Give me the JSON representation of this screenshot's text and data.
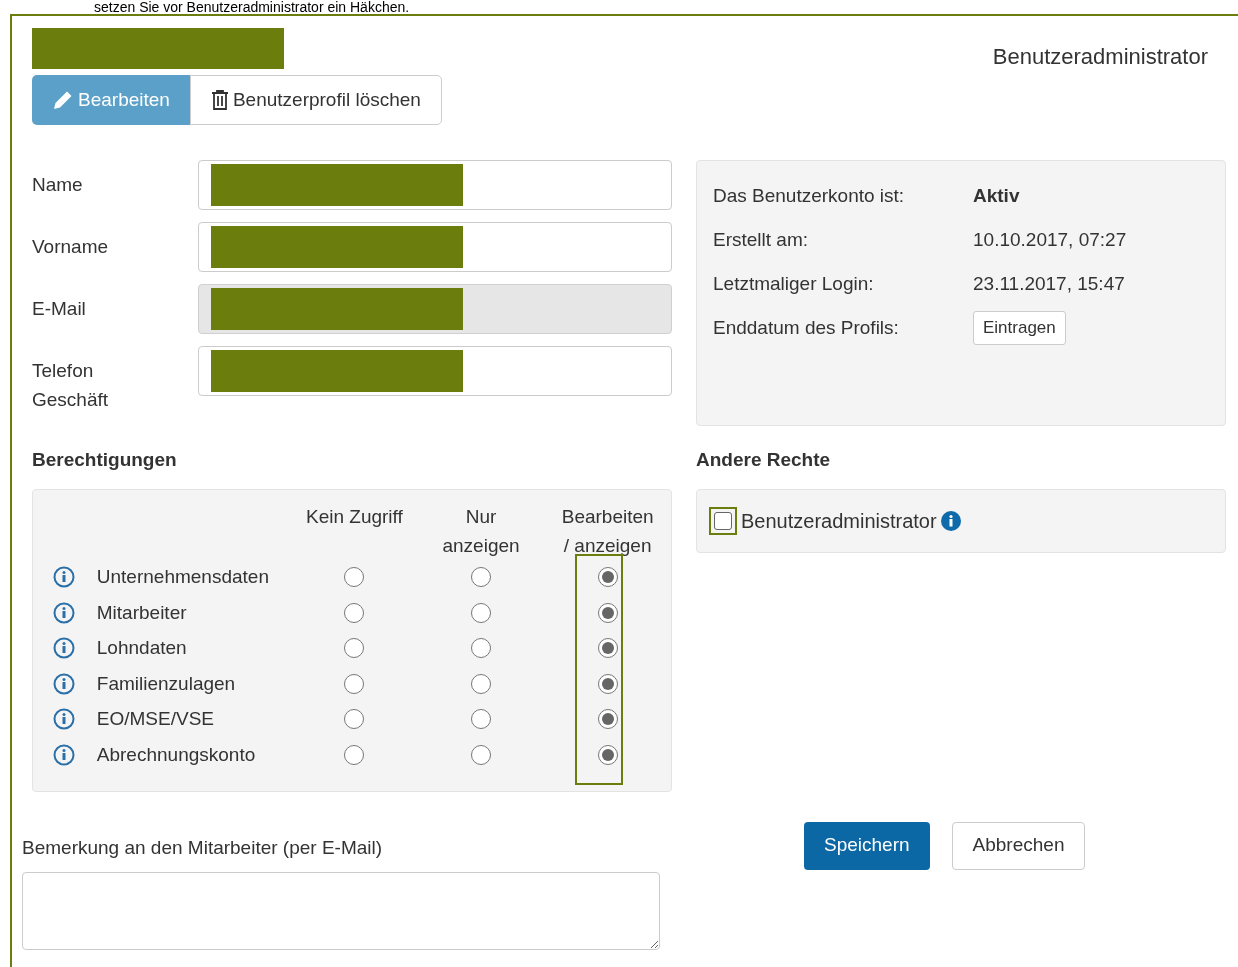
{
  "instruction": "setzen Sie vor Benutzeradministrator ein Häkchen.",
  "header": {
    "role": "Benutzeradministrator"
  },
  "actions": [
    {
      "label": "Bearbeiten",
      "kind": "primary"
    },
    {
      "label": "Benutzerprofil löschen",
      "kind": "delete"
    }
  ],
  "fields": [
    {
      "label": "Name",
      "disabled": false
    },
    {
      "label": "Vorname",
      "disabled": false
    },
    {
      "label": "E-Mail",
      "disabled": true
    },
    {
      "label": "Telefon Geschäft",
      "disabled": false
    }
  ],
  "account": [
    {
      "label": "Das Benutzerkonto ist:",
      "value": "Aktiv",
      "kind": "bold"
    },
    {
      "label": "Erstellt am:",
      "value": "10.10.2017, 07:27",
      "kind": "text"
    },
    {
      "label": "Letztmaliger Login:",
      "value": "23.11.2017, 15:47",
      "kind": "text"
    },
    {
      "label": "Enddatum des Profils:",
      "value": "Eintragen",
      "kind": "button"
    }
  ],
  "permissions": {
    "title": "Berechtigungen",
    "columns": [
      "Kein Zugriff",
      "Nur anzeigen",
      "Bearbeiten / anzeigen"
    ],
    "rows": [
      {
        "label": "Unternehmensdaten",
        "options": [
          {
            "selected": false
          },
          {
            "selected": false
          },
          {
            "selected": true
          }
        ]
      },
      {
        "label": "Mitarbeiter",
        "options": [
          {
            "selected": false
          },
          {
            "selected": false
          },
          {
            "selected": true
          }
        ]
      },
      {
        "label": "Lohndaten",
        "options": [
          {
            "selected": false
          },
          {
            "selected": false
          },
          {
            "selected": true
          }
        ]
      },
      {
        "label": "Familienzulagen",
        "options": [
          {
            "selected": false
          },
          {
            "selected": false
          },
          {
            "selected": true
          }
        ]
      },
      {
        "label": "EO/MSE/VSE",
        "options": [
          {
            "selected": false
          },
          {
            "selected": false
          },
          {
            "selected": true
          }
        ]
      },
      {
        "label": "Abrechnungskonto",
        "options": [
          {
            "selected": false
          },
          {
            "selected": false
          },
          {
            "selected": true
          }
        ]
      }
    ]
  },
  "other_rights": {
    "title": "Andere Rechte",
    "items": [
      {
        "label": "Benutzeradministrator",
        "checked": false
      }
    ]
  },
  "remark": {
    "label": "Bemerkung an den Mitarbeiter (per E-Mail)"
  },
  "buttons": [
    {
      "label": "Speichern",
      "kind": "primary"
    },
    {
      "label": "Abbrechen",
      "kind": "default"
    }
  ]
}
